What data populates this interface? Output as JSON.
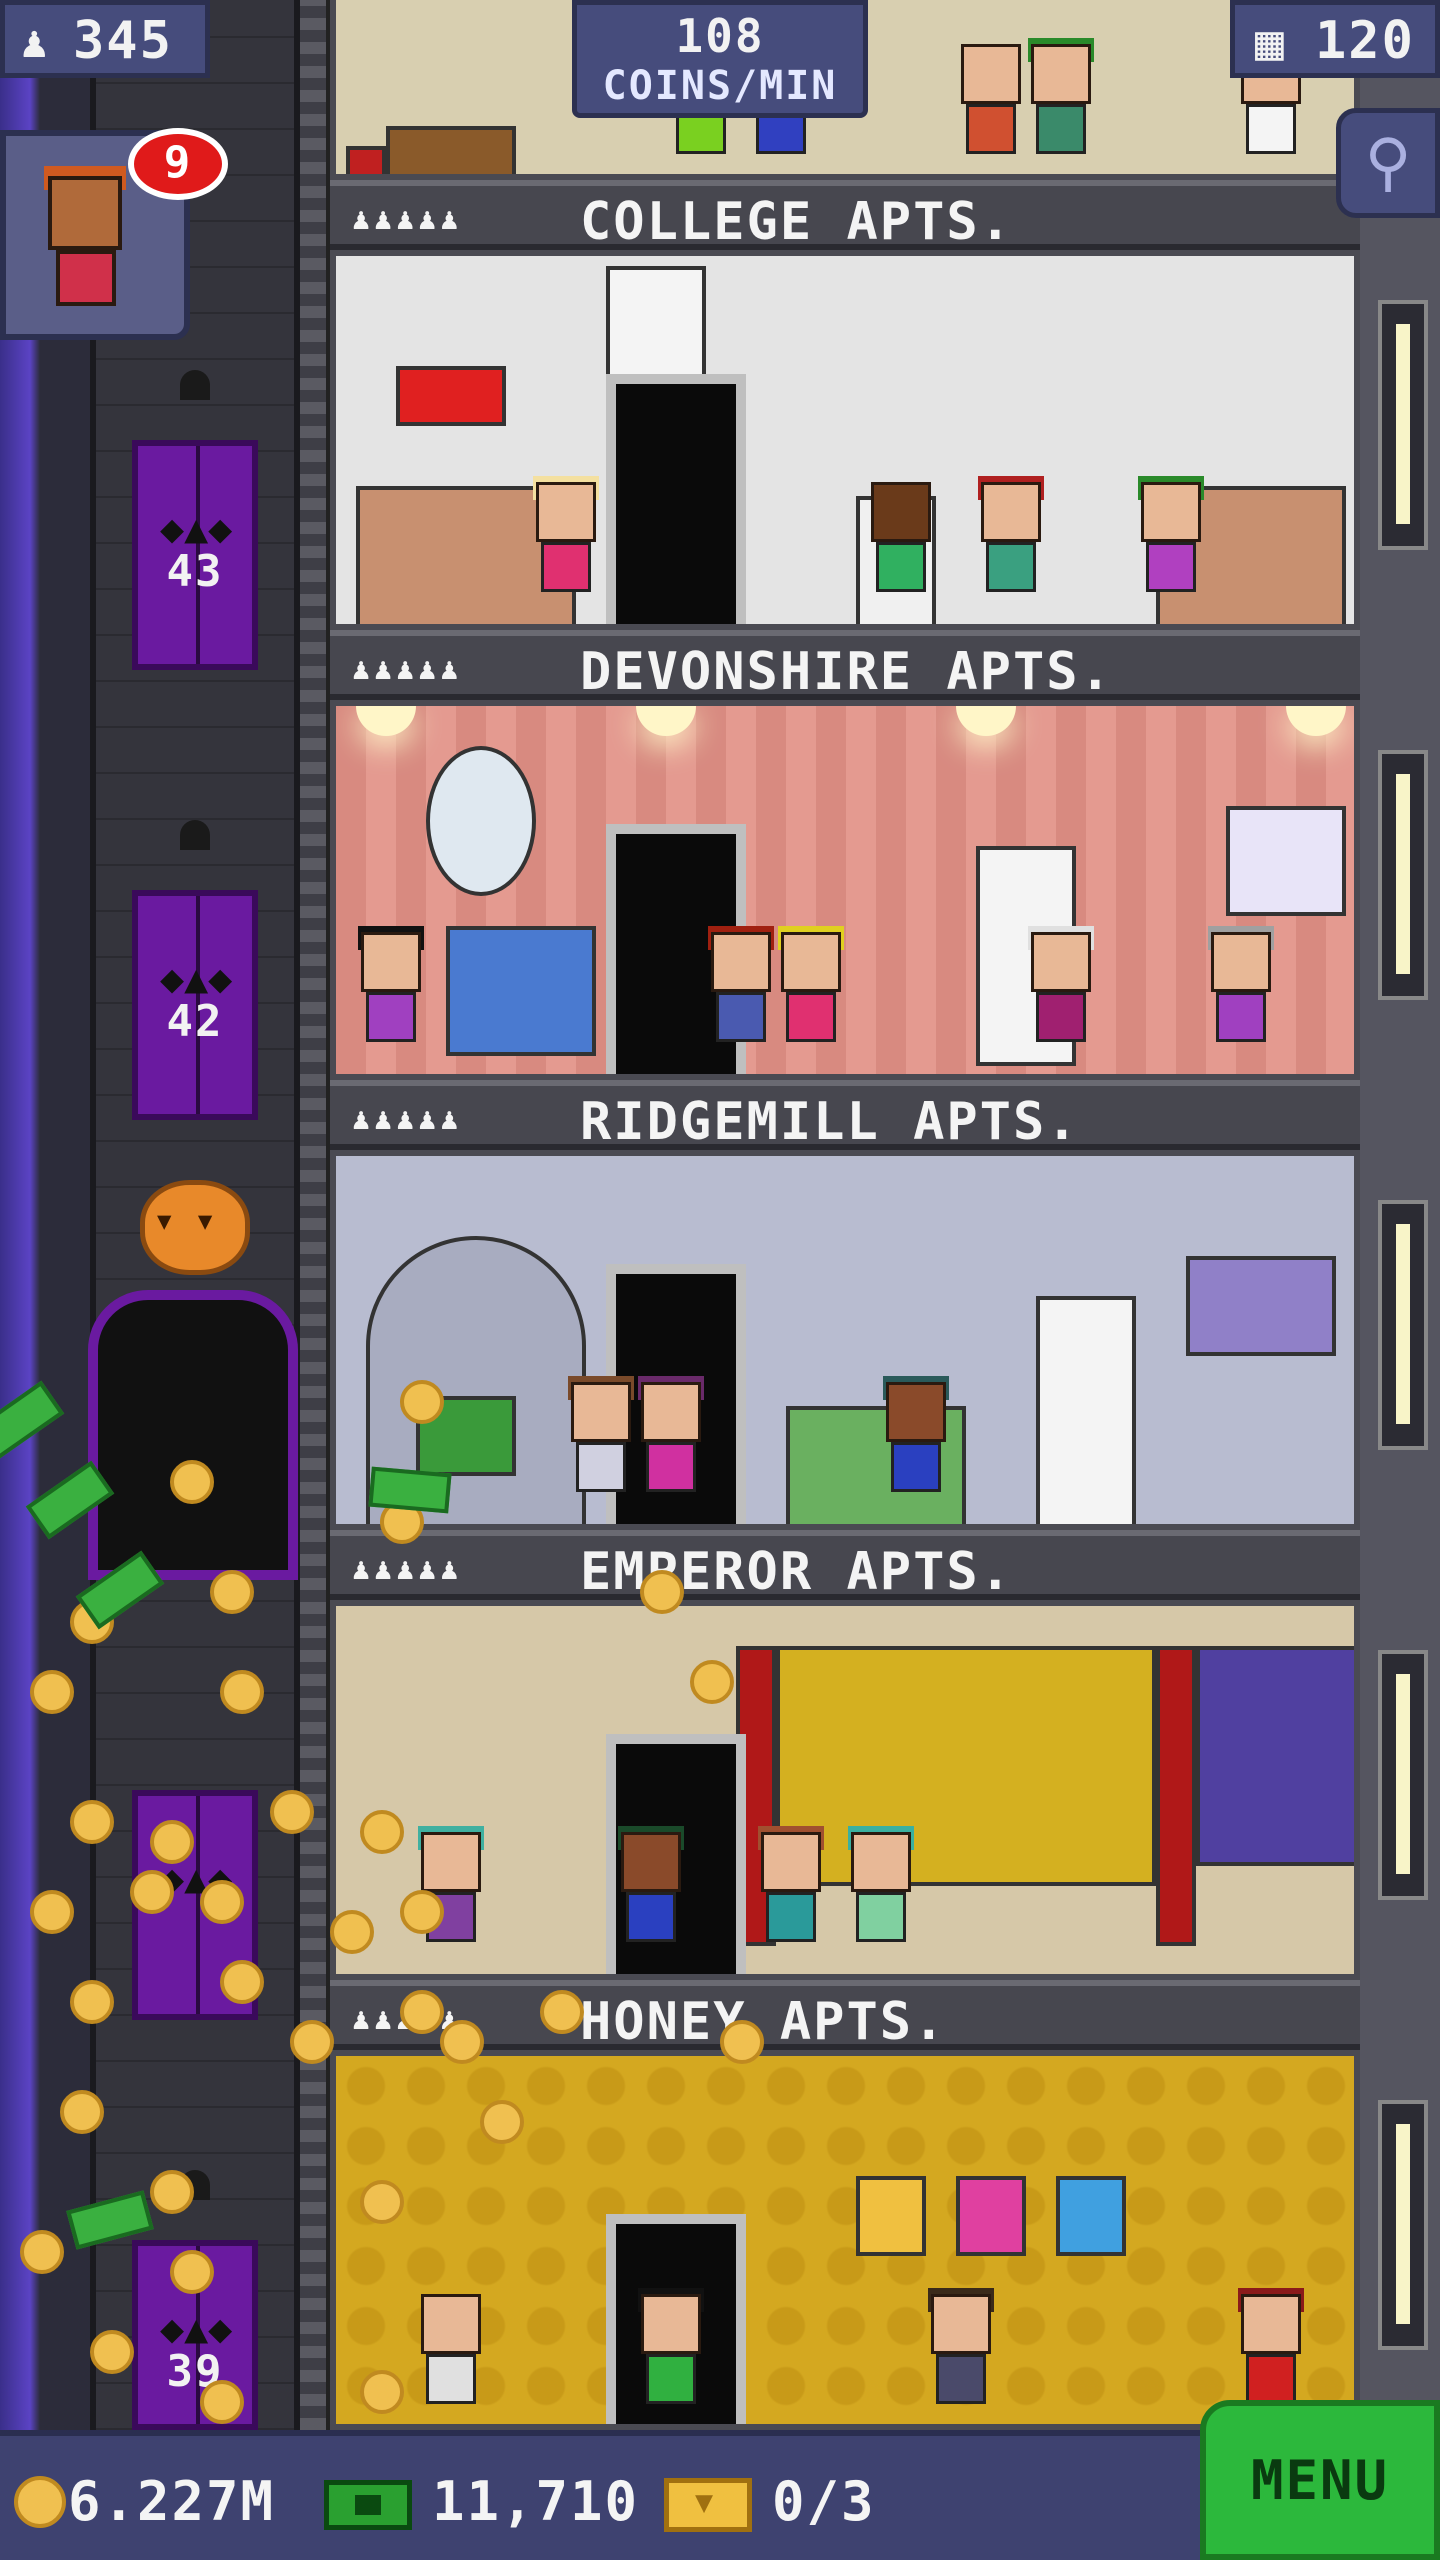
{
  "hud": {
    "population": "345",
    "coins_per_min_value": "108",
    "coins_per_min_label": "COINS/MIN",
    "floor_count": "120"
  },
  "visitor": {
    "badge_count": "9"
  },
  "elevator": {
    "floor_numbers": [
      "43",
      "42",
      "39"
    ]
  },
  "floors": [
    {
      "name": "COLLEGE APTS.",
      "wall_color": "#d8cfb0"
    },
    {
      "name": "DEVONSHIRE APTS.",
      "wall_color": "#e4e4e4"
    },
    {
      "name": "RIDGEMILL APTS.",
      "wall_color": "#d88a80"
    },
    {
      "name": "EMPEROR APTS.",
      "wall_color": "#b8bcd0"
    },
    {
      "name": "HONEY APTS.",
      "wall_color": "#d6c8a8"
    },
    {
      "name": "",
      "wall_color": "#d4a820"
    }
  ],
  "occupancy_icons": "♟♟♟♟♟",
  "bottom": {
    "coins": "6.227M",
    "bux": "11,710",
    "tickets": "0/3",
    "menu_label": "MENU"
  },
  "colors": {
    "hud_bg": "#464c7c",
    "menu_green": "#2cb83c",
    "elevator_purple": "#6a1aa0"
  }
}
